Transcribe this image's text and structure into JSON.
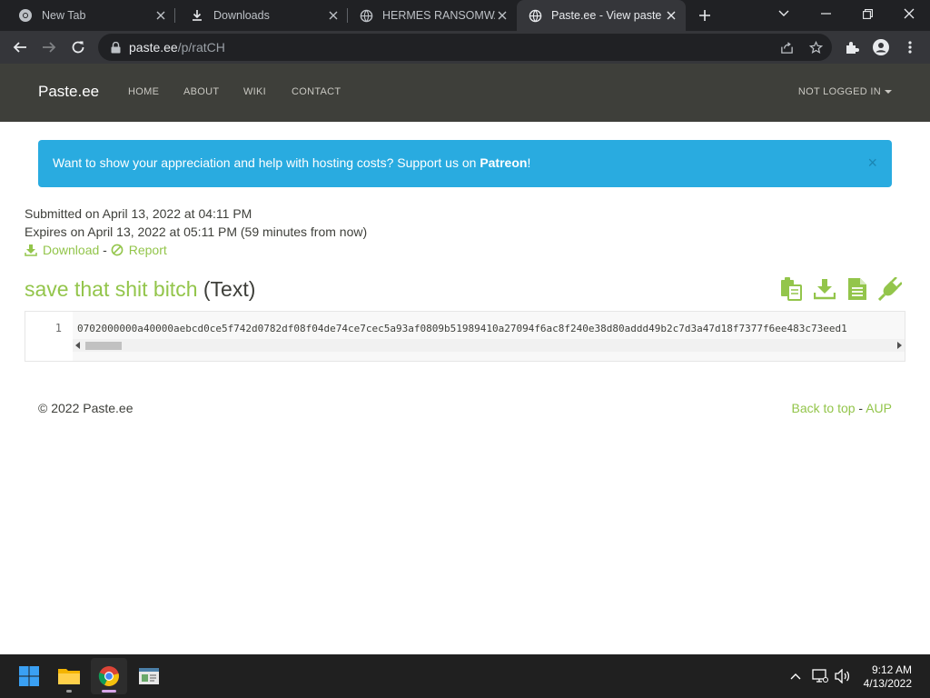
{
  "browser": {
    "tabs": [
      {
        "title": "New Tab",
        "icon": "chrome-icon",
        "active": false
      },
      {
        "title": "Downloads",
        "icon": "download-icon",
        "active": false
      },
      {
        "title": "HERMES RANSOMWAR",
        "icon": "globe-icon",
        "active": false
      },
      {
        "title": "Paste.ee - View paste r",
        "icon": "globe-icon",
        "active": true
      }
    ],
    "url_host": "paste.ee",
    "url_path": "/p/ratCH"
  },
  "site": {
    "brand": "Paste.ee",
    "nav": [
      "HOME",
      "ABOUT",
      "WIKI",
      "CONTACT"
    ],
    "user_menu": "NOT LOGGED IN"
  },
  "alert": {
    "text": "Want to show your appreciation and help with hosting costs? Support us on ",
    "link": "Patreon",
    "suffix": "!",
    "close": "×"
  },
  "paste": {
    "submitted": "Submitted on April 13, 2022 at 04:11 PM",
    "expires": "Expires on April 13, 2022 at 05:11 PM (59 minutes from now)",
    "download_label": "Download",
    "separator": " - ",
    "report_label": "Report",
    "title": "save that shit bitch",
    "format": "(Text)",
    "line_number": "1",
    "content": "0702000000a40000aebcd0ce5f742d0782df08f04de74ce7cec5a93af0809b51989410a27094f6ac8f240e38d80addd49b2c7d3a47d18f7377f6ee483c73eed1"
  },
  "footer": {
    "copyright": "© 2022 Paste.ee",
    "back_to_top": "Back to top",
    "dash": " - ",
    "aup": "AUP"
  },
  "taskbar": {
    "time": "9:12 AM",
    "date": "4/13/2022"
  },
  "colors": {
    "accent_green": "#93c54b",
    "navbar": "#3e3f3a",
    "alert_blue": "#29abe0"
  }
}
